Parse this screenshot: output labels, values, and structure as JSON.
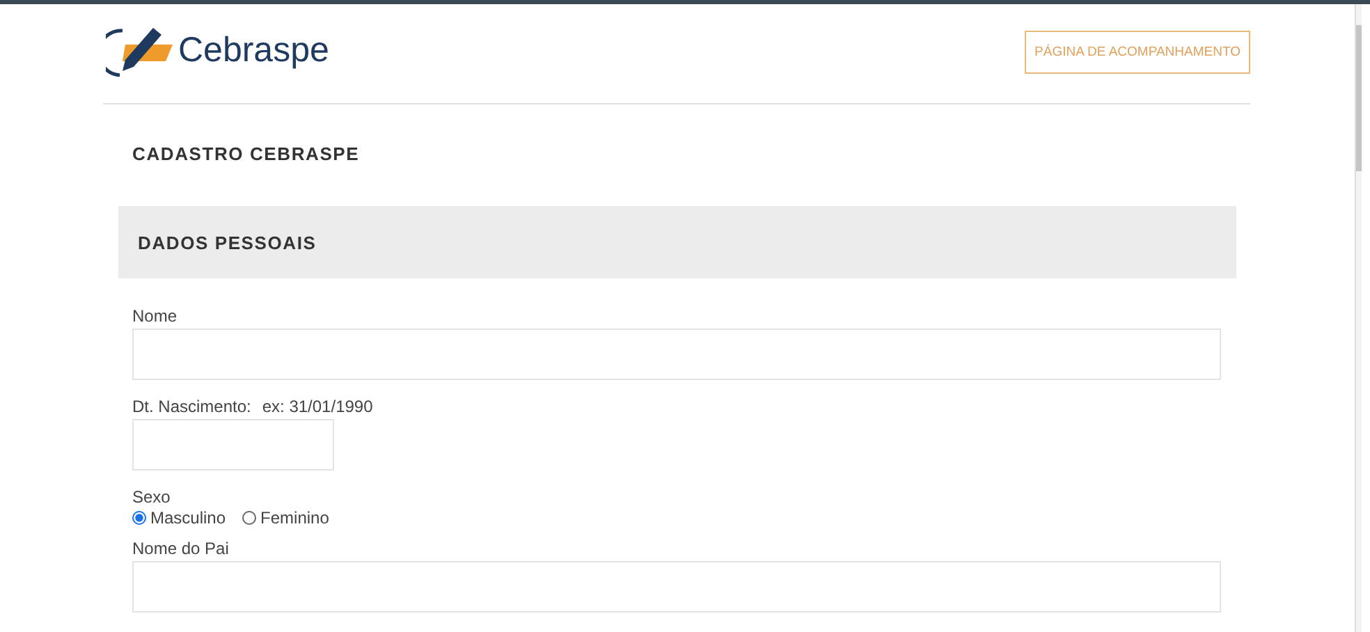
{
  "header": {
    "brand": "Cebraspe",
    "link": "PÁGINA DE ACOMPANHAMENTO"
  },
  "page_title": "CADASTRO CEBRASPE",
  "section": {
    "title": "DADOS PESSOAIS",
    "fields": [
      {
        "kind": "text",
        "label": "Nome"
      },
      {
        "kind": "date",
        "label": "Dt. Nascimento:",
        "hint": "ex: 31/01/1990"
      },
      {
        "kind": "radio",
        "label": "Sexo",
        "options": [
          {
            "label": "Masculino",
            "selected": true
          },
          {
            "label": "Feminino",
            "selected": false
          }
        ]
      },
      {
        "kind": "text",
        "label": "Nome do Pai"
      }
    ]
  }
}
